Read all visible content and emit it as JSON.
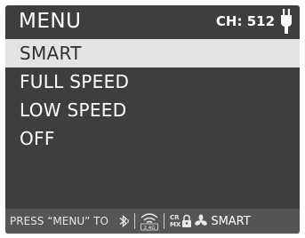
{
  "header": {
    "title": "MENU",
    "channel": "CH: 512",
    "icon": "plug-icon"
  },
  "menu": {
    "items": [
      {
        "label": "SMART",
        "selected": true
      },
      {
        "label": "FULL SPEED",
        "selected": false
      },
      {
        "label": "LOW SPEED",
        "selected": false
      },
      {
        "label": "OFF",
        "selected": false
      }
    ]
  },
  "footer": {
    "hint": "PRESS “MENU” TO",
    "band_label": "2.4G",
    "crmx_line1": "CR",
    "crmx_line2": "MX",
    "mode": "SMART",
    "icons": [
      "bluetooth-icon",
      "wifi-icon",
      "lock-icon",
      "fan-icon"
    ]
  },
  "colors": {
    "screen_bg": "#3e3e3e",
    "selected_bg": "#e3e3e3",
    "footer_bg": "#555555"
  }
}
